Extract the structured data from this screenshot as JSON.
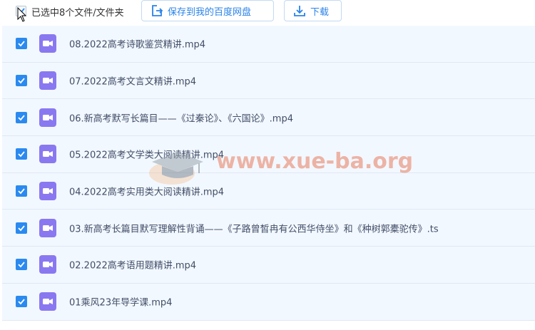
{
  "toolbar": {
    "selected_text": "已选中8个文件/文件夹",
    "save_label": "保存到我的百度网盘",
    "download_label": "下载",
    "save_icon": "save-to-netdisk-icon",
    "download_icon": "download-icon"
  },
  "files": [
    {
      "name": "08.2022高考诗歌鉴赏精讲.mp4",
      "checked": true,
      "icon": "video-file-icon"
    },
    {
      "name": "07.2022高考文言文精讲.mp4",
      "checked": true,
      "icon": "video-file-icon"
    },
    {
      "name": "06.新高考默写长篇目——《过秦论》、《六国论》.mp4",
      "checked": true,
      "icon": "video-file-icon"
    },
    {
      "name": "05.2022高考文学类大阅读精讲.mp4",
      "checked": true,
      "icon": "video-file-icon"
    },
    {
      "name": "04.2022高考实用类大阅读精讲.mp4",
      "checked": true,
      "icon": "video-file-icon"
    },
    {
      "name": "03.新高考长篇目默写理解性背诵——《子路曾皙冉有公西华侍坐》和《种树郭橐驼传》.ts",
      "checked": true,
      "icon": "video-file-icon"
    },
    {
      "name": "02.2022高考语用题精讲.mp4",
      "checked": true,
      "icon": "video-file-icon"
    },
    {
      "name": "01乘风23年导学课.mp4",
      "checked": true,
      "icon": "video-file-icon"
    }
  ],
  "watermark": {
    "text": "www.xue-ba.org"
  },
  "colors": {
    "accent": "#2a8af0",
    "row_bg": "#f2f8ff",
    "file_icon": "#8a78f0",
    "watermark": "#e87b5c"
  }
}
